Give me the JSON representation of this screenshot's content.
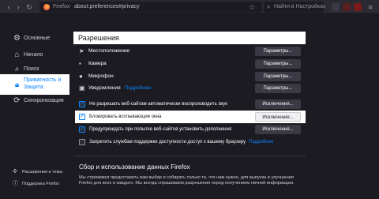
{
  "browser": {
    "brand": "Firefox",
    "url": "about:preferences#privacy",
    "search_placeholder": "Найти в Настройках",
    "accent": "#0a84ff",
    "background": "#1c1b22"
  },
  "sidebar": {
    "items": [
      {
        "label": "Основные",
        "icon": "gear-icon"
      },
      {
        "label": "Начало",
        "icon": "home-icon"
      },
      {
        "label": "Поиск",
        "icon": "search-icon"
      },
      {
        "label": "Приватность и Защита",
        "icon": "lock-icon",
        "active": true
      },
      {
        "label": "Синхронизация",
        "icon": "sync-icon"
      }
    ],
    "footer": [
      {
        "label": "Расширения и темы",
        "icon": "puzzle-icon"
      },
      {
        "label": "Поддержка Firefox",
        "icon": "help-icon"
      }
    ]
  },
  "permissions": {
    "title": "Разрешения",
    "rows": [
      {
        "label": "Местоположение",
        "button": "Параметры..."
      },
      {
        "label": "Камера",
        "button": "Параметры..."
      },
      {
        "label": "Микрофон",
        "button": "Параметры..."
      },
      {
        "label": "Уведомления",
        "link": "Подробнее",
        "button": "Параметры..."
      }
    ],
    "checks": [
      {
        "label": "Не разрешать веб-сайтам автоматически воспроизводить звук",
        "checked": true,
        "button": "Исключения..."
      },
      {
        "label": "Блокировать всплывающие окна",
        "checked": true,
        "button": "Исключения..."
      },
      {
        "label": "Предупреждать при попытке веб-сайтов установить дополнения",
        "checked": true,
        "button": "Исключения..."
      },
      {
        "label": "Запретить службам поддержки доступности доступ к вашему браузеру",
        "checked": false,
        "link": "Подробнее"
      }
    ]
  },
  "data_collection": {
    "title": "Сбор и использование данных Firefox",
    "text": "Мы стремимся предоставить вам выбор и собирать только то, что нам нужно, для выпуска и улучшения Firefox для всех и каждого. Мы всегда спрашиваем разрешения перед получением личной информации."
  }
}
